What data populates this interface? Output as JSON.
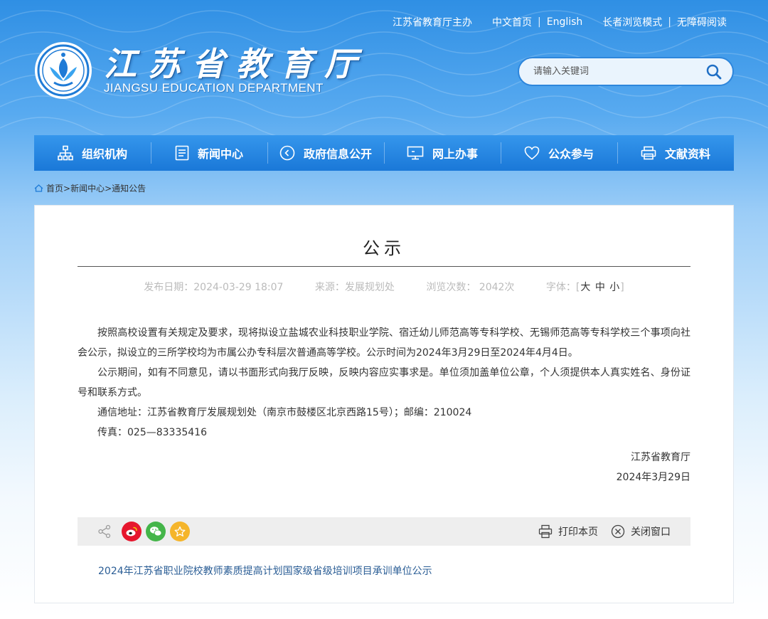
{
  "header": {
    "top_links": {
      "organizer": "江苏省教育厅主办",
      "chinese_home": "中文首页",
      "english": "English",
      "elder_mode": "长者浏览模式",
      "accessible": "无障碍阅读"
    },
    "logo_cn": "江苏省教育厅",
    "logo_en": "JIANGSU EDUCATION DEPARTMENT",
    "search_placeholder": "请输入关键词"
  },
  "nav": [
    {
      "label": "组织机构",
      "icon": "org-chart-icon"
    },
    {
      "label": "新闻中心",
      "icon": "document-icon"
    },
    {
      "label": "政府信息公开",
      "icon": "play-circle-icon"
    },
    {
      "label": "网上办事",
      "icon": "monitor-icon"
    },
    {
      "label": "公众参与",
      "icon": "heart-icon"
    },
    {
      "label": "文献资料",
      "icon": "printer-icon"
    }
  ],
  "breadcrumb": {
    "home": "首页",
    "sep": ">",
    "section": "新闻中心",
    "current": "通知公告"
  },
  "article": {
    "title": "公示",
    "publish_date": "发布日期：2024-03-29 18:07",
    "source": "来源：发展规划处",
    "views": "浏览次数：  2042次",
    "font_label": "字体：[",
    "font_large": "大",
    "font_medium": "中",
    "font_small": "小",
    "font_close": "]",
    "paragraphs": [
      "按照高校设置有关规定及要求，现将拟设立盐城农业科技职业学院、宿迁幼儿师范高等专科学校、无锡师范高等专科学校三个事项向社会公示，拟设立的三所学校均为市属公办专科层次普通高等学校。公示时间为2024年3月29日至2024年4月4日。",
      "公示期间，如有不同意见，请以书面形式向我厅反映，反映内容应实事求是。单位须加盖单位公章，个人须提供本人真实姓名、身份证号和联系方式。",
      "通信地址：江苏省教育厅发展规划处（南京市鼓楼区北京西路15号）；邮编：210024",
      "传真：025—83335416"
    ],
    "signature": "江苏省教育厅",
    "sign_date": "2024年3月29日"
  },
  "share": {
    "print": "打印本页",
    "close": "关闭窗口"
  },
  "related": {
    "link_text": "2024年江苏省职业院校教师素质提高计划国家级省级培训项目承训单位公示"
  },
  "colors": {
    "nav_blue": "#1a78d8",
    "weibo": "#e6162d",
    "wechat": "#44b549",
    "favorite": "#f5b52b"
  }
}
